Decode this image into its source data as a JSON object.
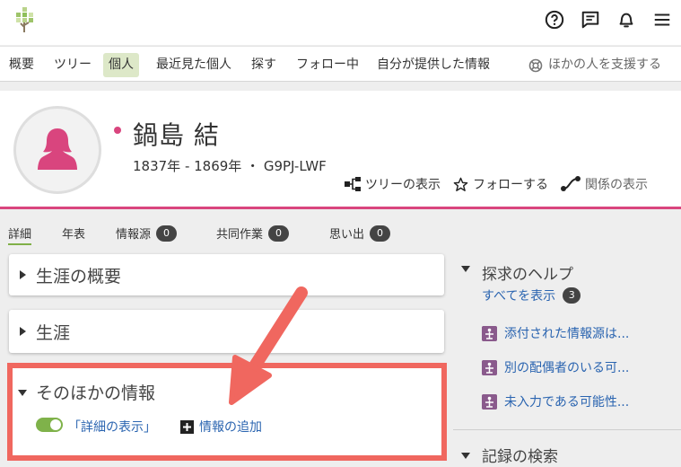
{
  "nav": {
    "items": [
      {
        "label": "概要",
        "active": false
      },
      {
        "label": "ツリー",
        "active": false
      },
      {
        "label": "個人",
        "active": true
      },
      {
        "label": "最近見た個人",
        "active": false
      },
      {
        "label": "探す",
        "active": false
      },
      {
        "label": "フォロー中",
        "active": false
      },
      {
        "label": "自分が提供した情報",
        "active": false
      }
    ],
    "help_label": "ほかの人を支援する"
  },
  "header_icons": [
    "help-circle-icon",
    "chat-icon",
    "bell-icon",
    "menu-icon"
  ],
  "person": {
    "name": "鍋島 結",
    "meta": "1837年 ‐ 1869年 ・ G9PJ-LWF",
    "actions": {
      "tree": "ツリーの表示",
      "follow": "フォローする",
      "relation": "関係の表示"
    }
  },
  "tabs": {
    "details": "詳細",
    "timeline": "年表",
    "sources": "情報源",
    "sources_count": "0",
    "collab": "共同作業",
    "collab_count": "0",
    "memories": "思い出",
    "memories_count": "0"
  },
  "cards": {
    "summary": "生涯の概要",
    "life": "生涯",
    "other": "そのほかの情報",
    "show_details": "「詳細の表示」",
    "add_info": "情報の追加"
  },
  "sidebar": {
    "research_help": "探求のヘルプ",
    "show_all": "すべてを表示",
    "show_all_count": "3",
    "hints": [
      "添付された情報源は...",
      "別の配偶者のいる可...",
      "未入力である可能性..."
    ],
    "record_search": "記録の検索"
  },
  "colors": {
    "accent_pink": "#d9457e",
    "accent_green": "#7fb24a",
    "highlight_red": "#f0675f",
    "link_blue": "#2a64b0",
    "hint_purple": "#8a5a8c"
  }
}
